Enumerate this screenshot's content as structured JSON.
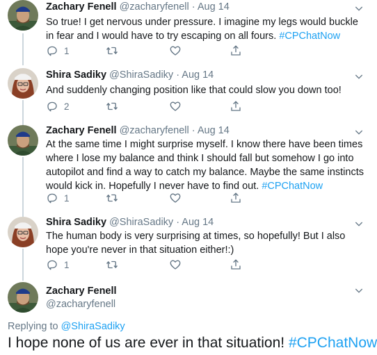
{
  "colors": {
    "accent": "#1da1f2",
    "secondary_text": "#657786",
    "thread_line": "#ccd6dd"
  },
  "tweets": [
    {
      "name": "Zachary Fenell",
      "handle": "@zacharyfenell",
      "dot": "·",
      "date": "Aug 14",
      "text_plain": "So true! I get nervous under pressure. I imagine my legs would buckle in fear and I would have to try escaping on all fours. ",
      "hashtag": "#CPChatNow",
      "reply_count": "1",
      "avatar_icon": "avatar-zachary"
    },
    {
      "name": "Shira Sadiky",
      "handle": "@ShiraSadiky",
      "dot": "·",
      "date": "Aug 14",
      "text_plain": "And suddenly changing position like that could slow you down too!",
      "hashtag": "",
      "reply_count": "2",
      "avatar_icon": "avatar-shira"
    },
    {
      "name": "Zachary Fenell",
      "handle": "@zacharyfenell",
      "dot": "·",
      "date": "Aug 14",
      "text_plain": "At the same time I might surprise myself. I know there have been times where I lose my balance and think I should fall but somehow I go into autopilot and find a way to catch my balance. Maybe the same instincts would kick in. Hopefully I never have to find out. ",
      "hashtag": "#CPChatNow",
      "reply_count": "1",
      "avatar_icon": "avatar-zachary"
    },
    {
      "name": "Shira Sadiky",
      "handle": "@ShiraSadiky",
      "dot": "·",
      "date": "Aug 14",
      "text_plain": "The human body is very surprising at times, so hopefully! But I also hope you're never in that situation either!:)",
      "hashtag": "",
      "reply_count": "1",
      "avatar_icon": "avatar-shira"
    }
  ],
  "main_tweet": {
    "name": "Zachary Fenell",
    "handle": "@zacharyfenell",
    "replying_label": "Replying to ",
    "replying_to": "@ShiraSadiky",
    "text_plain": "I hope none of us are ever in that situation! ",
    "hashtag": "#CPChatNow"
  },
  "icons": {
    "reply": "reply-icon",
    "retweet": "retweet-icon",
    "like": "heart-icon",
    "share": "share-icon",
    "menu": "chevron-down-icon"
  }
}
